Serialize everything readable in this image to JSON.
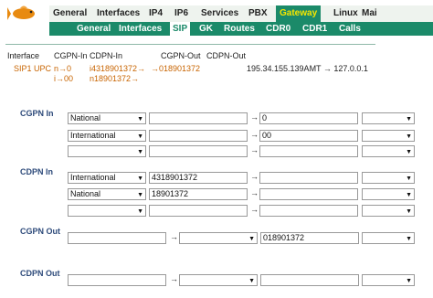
{
  "nav": {
    "top": [
      "General",
      "Interfaces",
      "IP4",
      "IP6",
      "Services",
      "PBX",
      "Gateway",
      "Linux",
      "Mai"
    ],
    "active_top": "Gateway",
    "sub": [
      "General",
      "Interfaces",
      "SIP",
      "GK",
      "Routes",
      "CDR0",
      "CDR1",
      "Calls"
    ],
    "active_sub": "SIP"
  },
  "summary": {
    "headers": [
      "Interface",
      "CGPN-In",
      "CDPN-In",
      "CGPN-Out",
      "CDPN-Out"
    ],
    "interface": "SIP1 UPC",
    "cgpn_in_1": "n→0",
    "cgpn_in_2": "i→00",
    "cdpn_in_1": "i4318901372→",
    "cdpn_in_2": "n18901372→",
    "cgpn_out": "→018901372",
    "addr": "195.34.155.139AMT → 127.0.0.1"
  },
  "sections": {
    "cgpn_in": "CGPN In",
    "cdpn_in": "CDPN In",
    "cgpn_out": "CGPN Out",
    "cdpn_out": "CDPN Out"
  },
  "cgpn_in_rows": [
    {
      "type": "National",
      "match": "",
      "result": "0"
    },
    {
      "type": "International",
      "match": "",
      "result": "00"
    },
    {
      "type": "",
      "match": "",
      "result": ""
    }
  ],
  "cdpn_in_rows": [
    {
      "type": "International",
      "match": "4318901372",
      "result": ""
    },
    {
      "type": "National",
      "match": "18901372",
      "result": ""
    },
    {
      "type": "",
      "match": "",
      "result": ""
    }
  ],
  "cgpn_out_row": {
    "match": "",
    "type": "",
    "result": "018901372"
  },
  "arrow": "→",
  "dropdown_icon": "chevron-down-icon",
  "colors": {
    "accent": "#1b8a69",
    "active_text": "#f5e600",
    "summary_text": "#c86400"
  }
}
